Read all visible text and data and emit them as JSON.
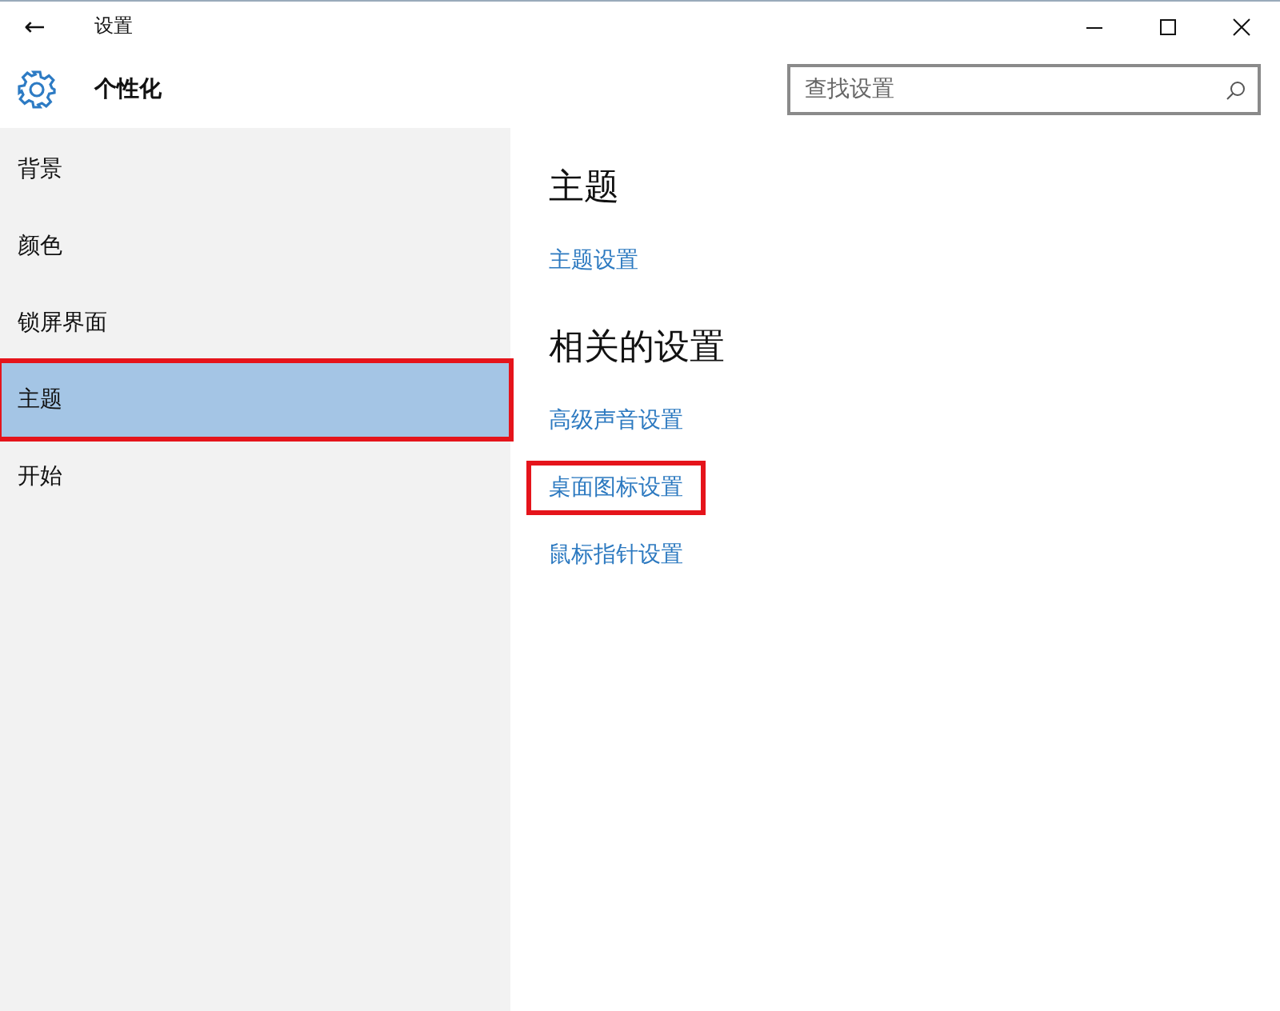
{
  "window": {
    "back": "←",
    "title": "设置",
    "controls": [
      {
        "kind": "minimize"
      },
      {
        "kind": "maximize"
      },
      {
        "kind": "close"
      }
    ]
  },
  "header": {
    "title": "个性化",
    "search": {
      "placeholder": "查找设置"
    }
  },
  "sidebar": {
    "items": [
      {
        "label": "背景",
        "selected": false,
        "highlighted": false
      },
      {
        "label": "颜色",
        "selected": false,
        "highlighted": false
      },
      {
        "label": "锁屏界面",
        "selected": false,
        "highlighted": false
      },
      {
        "label": "主题",
        "selected": true,
        "highlighted": true
      },
      {
        "label": "开始",
        "selected": false,
        "highlighted": false
      }
    ]
  },
  "content": {
    "sections": [
      {
        "heading": "主题",
        "links": [
          {
            "label": "主题设置",
            "highlighted": false
          }
        ]
      },
      {
        "heading": "相关的设置",
        "links": [
          {
            "label": "高级声音设置",
            "highlighted": false
          },
          {
            "label": "桌面图标设置",
            "highlighted": true
          },
          {
            "label": "鼠标指针设置",
            "highlighted": false
          }
        ]
      }
    ]
  }
}
